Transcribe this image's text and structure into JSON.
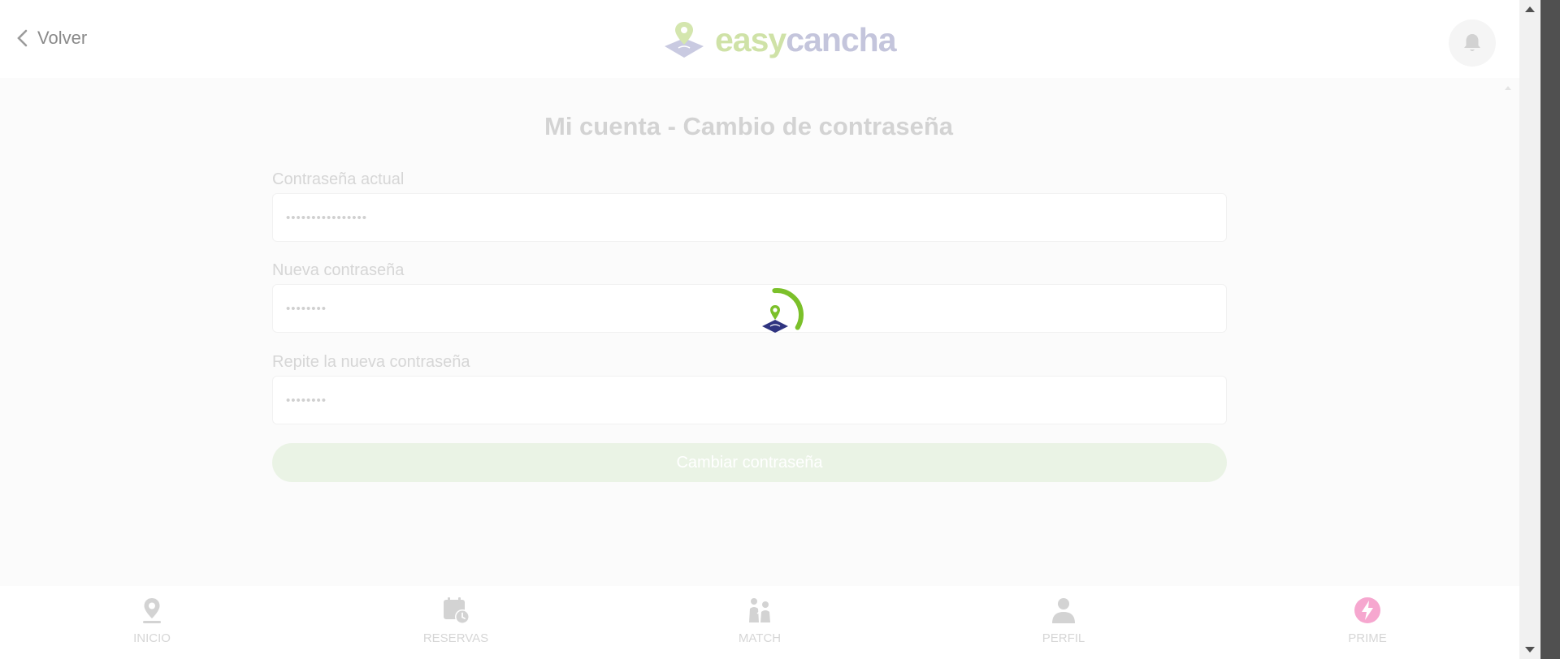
{
  "header": {
    "back_label": "Volver",
    "logo": {
      "easy": "easy",
      "cancha": "cancha"
    },
    "notifications_icon": "bell-icon"
  },
  "page": {
    "title": "Mi cuenta - Cambio de contraseña"
  },
  "form": {
    "current_password": {
      "label": "Contraseña actual",
      "value": "••••••••••••••••"
    },
    "new_password": {
      "label": "Nueva contraseña",
      "value": "••••••••"
    },
    "repeat_password": {
      "label": "Repite la nueva contraseña",
      "value": "••••••••"
    },
    "submit_label": "Cambiar contraseña"
  },
  "loading": {
    "spinner": "loading-spinner",
    "progress": 0.35
  },
  "bottom_nav": {
    "items": [
      {
        "label": "INICIO",
        "icon": "map-pin-icon"
      },
      {
        "label": "RESERVAS",
        "icon": "calendar-clock-icon"
      },
      {
        "label": "MATCH",
        "icon": "players-icon"
      },
      {
        "label": "PERFIL",
        "icon": "user-icon"
      },
      {
        "label": "PRIME",
        "icon": "lightning-badge-icon"
      }
    ]
  },
  "colors": {
    "brand_green": "#7bc02a",
    "brand_navy": "#2f3480",
    "prime_pink": "#f6a7cf"
  }
}
